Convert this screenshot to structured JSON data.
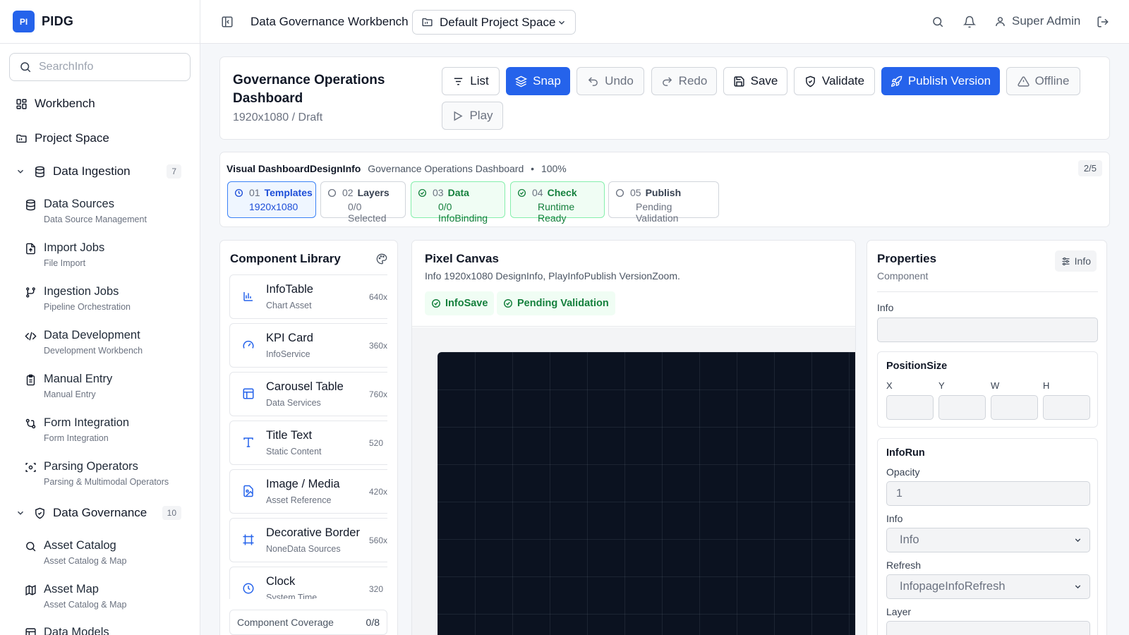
{
  "brand": {
    "logo_text": "PI",
    "name": "PIDG"
  },
  "search": {
    "placeholder": "SearchInfo"
  },
  "nav": {
    "workbench": "Workbench",
    "project_space": "Project Space",
    "groups": [
      {
        "label": "Data Ingestion",
        "count": "7",
        "items": [
          {
            "title": "Data Sources",
            "desc": "Data Source Management"
          },
          {
            "title": "Import Jobs",
            "desc": "File Import"
          },
          {
            "title": "Ingestion Jobs",
            "desc": "Pipeline Orchestration"
          },
          {
            "title": "Data Development",
            "desc": "Development Workbench"
          },
          {
            "title": "Manual Entry",
            "desc": "Manual Entry"
          },
          {
            "title": "Form Integration",
            "desc": "Form Integration"
          },
          {
            "title": "Parsing Operators",
            "desc": "Parsing & Multimodal Operators"
          }
        ]
      },
      {
        "label": "Data Governance",
        "count": "10",
        "items": [
          {
            "title": "Asset Catalog",
            "desc": "Asset Catalog & Map"
          },
          {
            "title": "Asset Map",
            "desc": "Asset Catalog & Map"
          },
          {
            "title": "Data Models",
            "desc": ""
          }
        ]
      }
    ]
  },
  "header": {
    "title": "Data Governance Workbench",
    "project": "Default Project Space",
    "user": "Super Admin"
  },
  "dashboard": {
    "title": "Governance Operations Dashboard",
    "subtitle": "1920x1080 / Draft",
    "buttons": {
      "list": "List",
      "snap": "Snap",
      "undo": "Undo",
      "redo": "Redo",
      "save": "Save",
      "validate": "Validate",
      "publish": "Publish Version",
      "offline": "Offline",
      "play": "Play"
    }
  },
  "stepper": {
    "heading": "Visual DashboardDesignInfo",
    "context": "Governance Operations Dashboard",
    "zoom": "100%",
    "progress": "2/5",
    "steps": [
      {
        "num": "01",
        "name": "Templates",
        "detail": "1920x1080",
        "state": "active"
      },
      {
        "num": "02",
        "name": "Layers",
        "detail": "0/0 Selected",
        "state": "pending"
      },
      {
        "num": "03",
        "name": "Data",
        "detail": "0/0 InfoBinding",
        "state": "done"
      },
      {
        "num": "04",
        "name": "Check",
        "detail": "Runtime Ready",
        "state": "done"
      },
      {
        "num": "05",
        "name": "Publish",
        "detail": "Pending Validation",
        "state": "pending"
      }
    ]
  },
  "library": {
    "title": "Component Library",
    "items": [
      {
        "name": "InfoTable",
        "desc": "Chart Asset",
        "size": "640x",
        "icon": "bar-chart-icon"
      },
      {
        "name": "KPI Card",
        "desc": "InfoService",
        "size": "360x",
        "icon": "gauge-icon"
      },
      {
        "name": "Carousel Table",
        "desc": "Data Services",
        "size": "760x",
        "icon": "table-icon"
      },
      {
        "name": "Title Text",
        "desc": "Static Content",
        "size": "520",
        "icon": "text-icon"
      },
      {
        "name": "Image / Media",
        "desc": "Asset Reference",
        "size": "420x",
        "icon": "image-icon"
      },
      {
        "name": "Decorative Border",
        "desc": "NoneData Sources",
        "size": "560x",
        "icon": "frame-icon"
      },
      {
        "name": "Clock",
        "desc": "System Time",
        "size": "320",
        "icon": "clock-icon"
      }
    ],
    "coverage_label": "Component Coverage",
    "coverage_value": "0/8"
  },
  "canvas": {
    "title": "Pixel Canvas",
    "desc": "Info 1920x1080 DesignInfo, PlayInfoPublish VersionZoom.",
    "tags": [
      "InfoSave",
      "Pending Validation"
    ]
  },
  "properties": {
    "title": "Properties",
    "subtitle": "Component",
    "info_button": "Info",
    "info_label": "Info",
    "position_title": "PositionSize",
    "x": "X",
    "y": "Y",
    "w": "W",
    "h": "H",
    "run_title": "InfoRun",
    "opacity_label": "Opacity",
    "opacity_value": "1",
    "info_select_label": "Info",
    "info_select_value": "Info",
    "refresh_label": "Refresh",
    "refresh_value": "InfopageInfoRefresh",
    "layer_label": "Layer"
  },
  "colors": {
    "primary": "#2563eb",
    "success": "#15803d",
    "canvas": "#0b1220"
  }
}
